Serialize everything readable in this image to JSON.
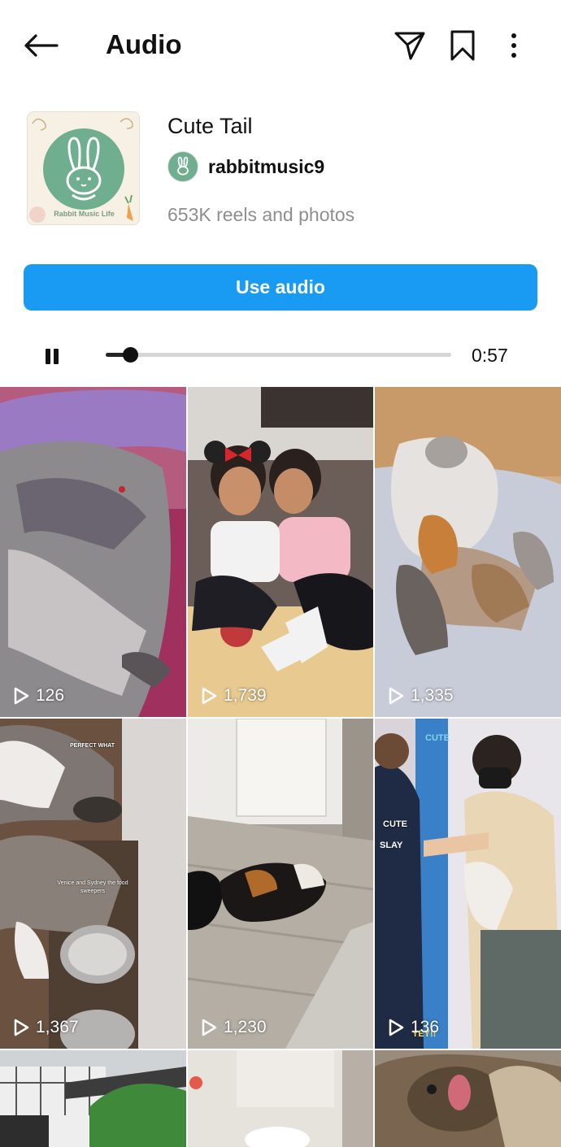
{
  "header": {
    "title": "Audio"
  },
  "icons": {
    "back": "arrow-left-icon",
    "send": "paper-plane-icon",
    "save": "bookmark-icon",
    "more": "more-vertical-icon",
    "play_count": "play-outline-icon"
  },
  "track": {
    "cover_text": "Rabbit Music Life",
    "title": "Cute Tail",
    "artist": "rabbitmusic9",
    "reel_count": "653K reels and photos"
  },
  "actions": {
    "use_audio": "Use audio"
  },
  "player": {
    "time": "0:57",
    "progress_fraction": 0.07,
    "state": "playing"
  },
  "reels": [
    {
      "views": "126"
    },
    {
      "views": "1,739"
    },
    {
      "views": "1,335"
    },
    {
      "views": "1,367",
      "caption_top": "PERFECT WHAT",
      "caption_mid": "Venice and Sydney the food sweepers"
    },
    {
      "views": "1,230"
    },
    {
      "views": "136",
      "stickers": [
        "CUTE",
        "SLAY",
        "CUTE",
        "YEY!!"
      ]
    },
    {
      "views": ""
    },
    {
      "views": ""
    },
    {
      "views": ""
    }
  ],
  "colors": {
    "accent": "#1a9bf3",
    "text_secondary": "#8e8e8e",
    "cover_green": "#6fae8e"
  }
}
